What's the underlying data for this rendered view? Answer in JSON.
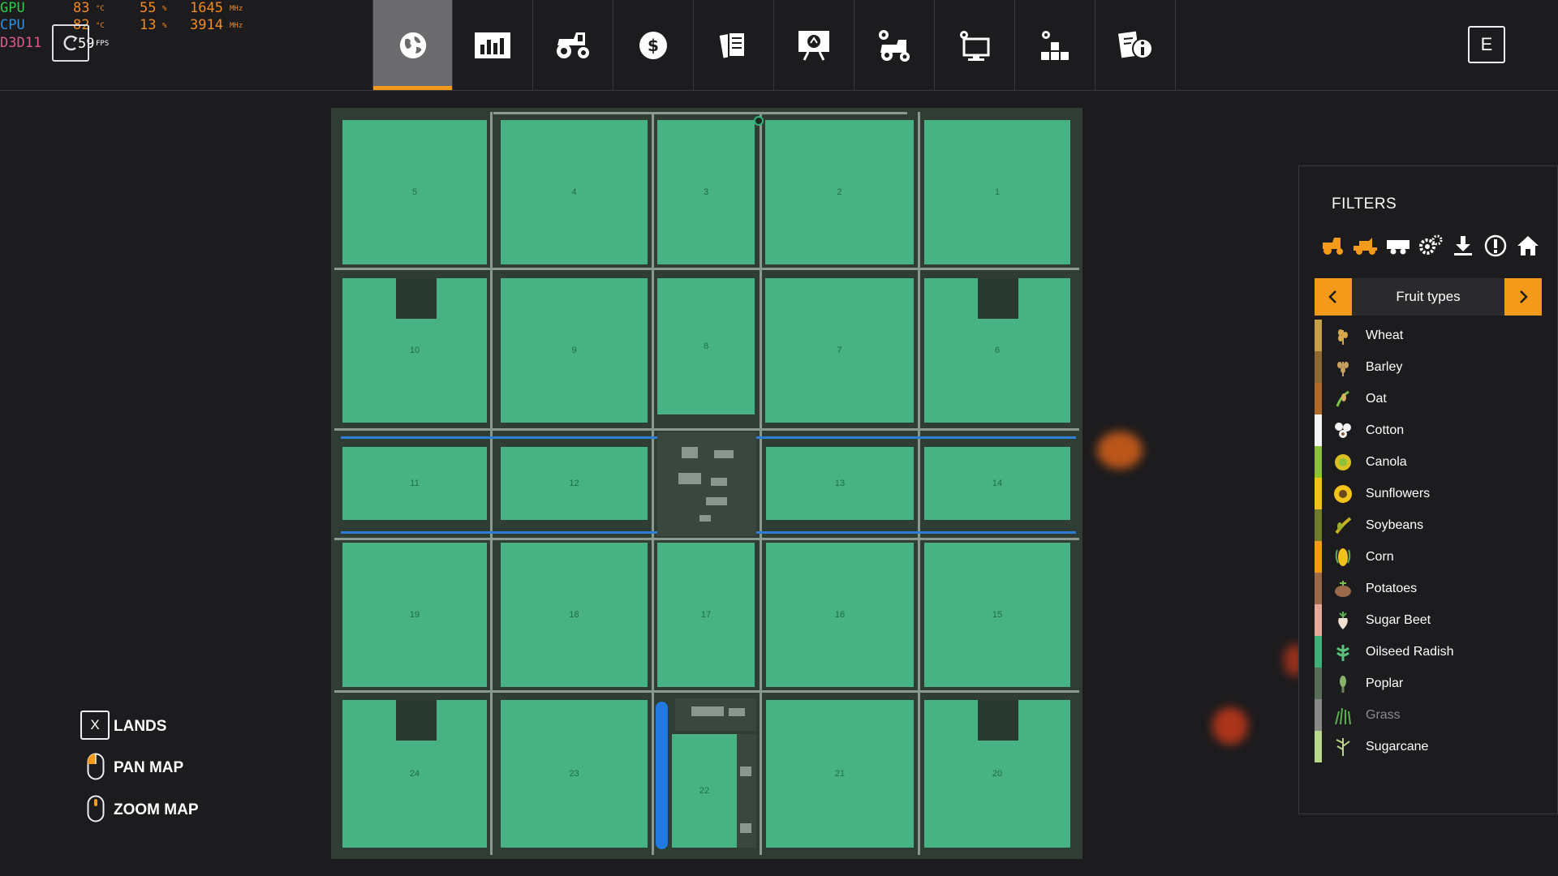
{
  "osd": {
    "gpu": {
      "label": "GPU",
      "temp": "83",
      "temp_unit": "°C",
      "load": "55",
      "load_unit": "%",
      "clock": "1645",
      "clock_unit": "MHz"
    },
    "cpu": {
      "label": "CPU",
      "temp": "82",
      "temp_unit": "°C",
      "load": "13",
      "load_unit": "%",
      "clock": "3914",
      "clock_unit": "MHz"
    },
    "api": "D3D11",
    "fps": "59",
    "fps_unit": "FPS"
  },
  "tabs": [
    {
      "name": "map",
      "icon": "globe-icon",
      "active": true
    },
    {
      "name": "statistics",
      "icon": "chart-icon"
    },
    {
      "name": "vehicles",
      "icon": "tractor-icon"
    },
    {
      "name": "finances",
      "icon": "dollar-icon"
    },
    {
      "name": "contracts",
      "icon": "contracts-icon"
    },
    {
      "name": "animals",
      "icon": "presentation-icon"
    },
    {
      "name": "production",
      "icon": "tractor-gear-icon"
    },
    {
      "name": "settings",
      "icon": "monitor-icon"
    },
    {
      "name": "general",
      "icon": "blocks-icon"
    },
    {
      "name": "help",
      "icon": "info-icon"
    }
  ],
  "close_key": "E",
  "fields": [
    "5",
    "4",
    "3",
    "2",
    "1",
    "10",
    "9",
    "8",
    "7",
    "6",
    "11",
    "12",
    "13",
    "14",
    "19",
    "18",
    "17",
    "16",
    "15",
    "24",
    "23",
    "22",
    "21",
    "20"
  ],
  "controls": {
    "lands_key": "X",
    "lands_label": "LANDS",
    "pan_label": "PAN MAP",
    "zoom_label": "ZOOM MAP"
  },
  "filters": {
    "title": "FILTERS",
    "icons": [
      "combine-icon",
      "harvester-icon",
      "trailer-icon",
      "gears-icon",
      "download-icon",
      "alert-icon",
      "home-icon"
    ],
    "selector_label": "Fruit types",
    "fruits": [
      {
        "name": "Wheat",
        "color": "#c9a04a"
      },
      {
        "name": "Barley",
        "color": "#8c6a32"
      },
      {
        "name": "Oat",
        "color": "#b06a2a"
      },
      {
        "name": "Cotton",
        "color": "#f4f4f4"
      },
      {
        "name": "Canola",
        "color": "#8bc23a"
      },
      {
        "name": "Sunflowers",
        "color": "#f2c21a"
      },
      {
        "name": "Soybeans",
        "color": "#6f7d2a"
      },
      {
        "name": "Corn",
        "color": "#f39a1a"
      },
      {
        "name": "Potatoes",
        "color": "#9a6a4a"
      },
      {
        "name": "Sugar Beet",
        "color": "#e8a89a"
      },
      {
        "name": "Oilseed Radish",
        "color": "#3fb07a"
      },
      {
        "name": "Poplar",
        "color": "#5a6e5a"
      },
      {
        "name": "Grass",
        "color": "#8a8a8a",
        "dim": true
      },
      {
        "name": "Sugarcane",
        "color": "#b8d88a"
      }
    ]
  }
}
